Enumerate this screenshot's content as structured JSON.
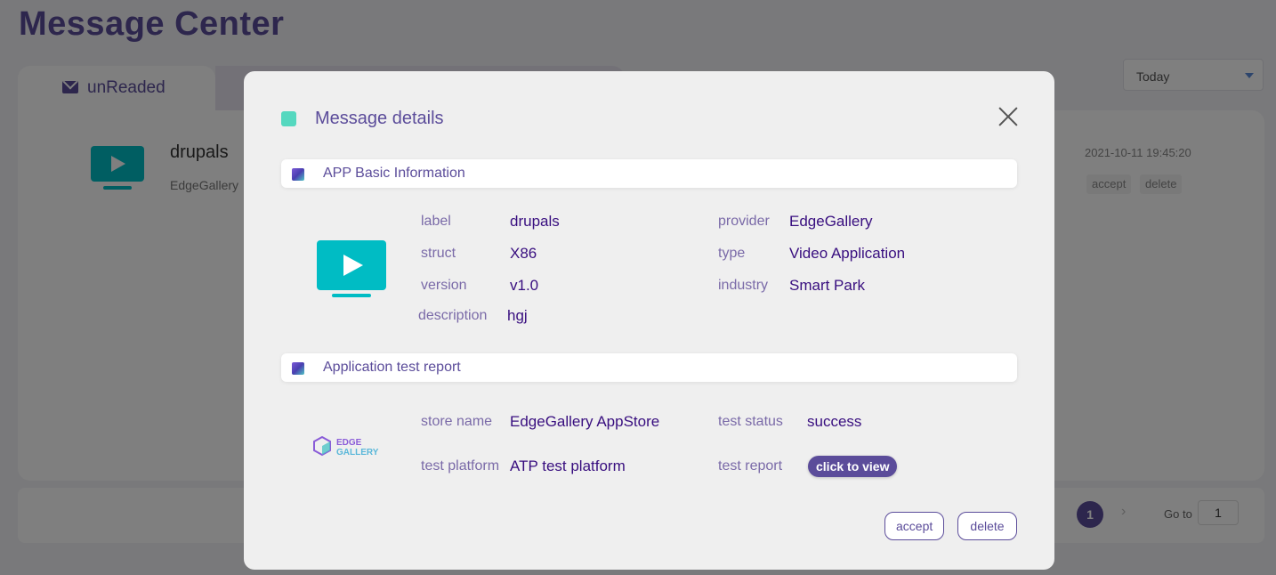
{
  "page": {
    "title": "Message Center",
    "tab_unread": "unReaded",
    "date_filter": "Today"
  },
  "message_row": {
    "title": "drupals",
    "subtitle": "EdgeGallery",
    "time": "2021-10-11 19:45:20",
    "accept_label": "accept",
    "delete_label": "delete"
  },
  "pagination": {
    "current_page": "1",
    "goto_label": "Go to",
    "goto_value": "1"
  },
  "dialog": {
    "title": "Message details",
    "basic_section": {
      "title": "APP Basic Information",
      "fields": {
        "label": {
          "name": "label",
          "value": "drupals"
        },
        "provider": {
          "name": "provider",
          "value": "EdgeGallery"
        },
        "struct": {
          "name": "struct",
          "value": "X86"
        },
        "type": {
          "name": "type",
          "value": "Video Application"
        },
        "version": {
          "name": "version",
          "value": "v1.0"
        },
        "industry": {
          "name": "industry",
          "value": "Smart Park"
        },
        "description": {
          "name": "description",
          "value": "hgj"
        }
      }
    },
    "report_section": {
      "title": "Application test report",
      "logo_text_line1": "EDGE",
      "logo_text_line2": "GALLERY",
      "fields": {
        "store_name": {
          "name": "store name",
          "value": "EdgeGallery AppStore"
        },
        "test_status": {
          "name": "test status",
          "value": "success"
        },
        "test_platform": {
          "name": "test platform",
          "value": "ATP test platform"
        },
        "test_report": {
          "name": "test report",
          "value": "click to view"
        }
      }
    },
    "accept_label": "accept",
    "delete_label": "delete"
  },
  "colors": {
    "primary": "#5b4c9a",
    "teal": "#00bcc4",
    "marker": "#55d8bf",
    "text": "#380e7f"
  },
  "icons": {
    "app_icon": "video-tv-icon",
    "close": "close-icon"
  }
}
